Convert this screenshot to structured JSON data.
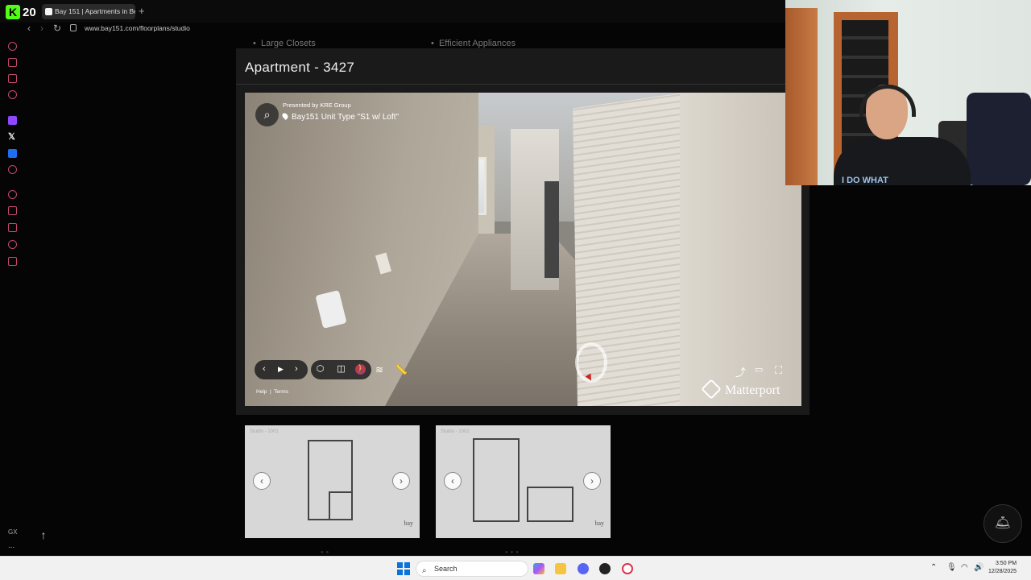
{
  "browser": {
    "kick_count": "20",
    "tab_title": "Bay 151 | Apartments in Be",
    "url": "www.bay151.com/floorplans/studio"
  },
  "page": {
    "amenities": [
      "Large Closets",
      "Efficient Appliances"
    ],
    "modal_title": "Apartment - 3427"
  },
  "viewer": {
    "presented_by": "Presented by KRE Group",
    "unit_type": "Bay151 Unit Type \"S1 w/ Loft\"",
    "help": "Help",
    "terms": "Terms",
    "brand": "Matterport"
  },
  "floorplans": [
    {
      "label": "Studio - 1001"
    },
    {
      "label": "Studio - 1002"
    }
  ],
  "sidebar": {
    "gx": "GX",
    "more": "..."
  },
  "taskbar": {
    "search_placeholder": "Search",
    "time": "3:50 PM",
    "date": "12/28/2025"
  },
  "webcam": {
    "shirt_text": "I DO WHAT"
  },
  "colors": {
    "accent": "#b73a5c",
    "kick_green": "#53fc18",
    "sidebar_icon": "#c4476d"
  }
}
